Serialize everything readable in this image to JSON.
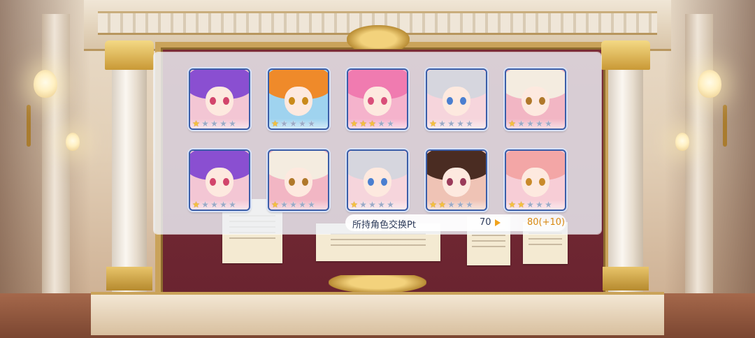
{
  "background": {
    "wall_color": "#e2cfb7",
    "board_color": "#6a2430",
    "gold_color": "#caa35a"
  },
  "panel": {
    "characters": [
      {
        "name_icon": "purple-hair-girl-portrait",
        "hair": "#8a4fd1",
        "eyes": "#d2456b",
        "bg": "#f3c6d4",
        "stars": 1
      },
      {
        "name_icon": "orange-hair-girl-portrait",
        "hair": "#ef8a2a",
        "eyes": "#c98a1a",
        "bg": "#9fd3ef",
        "stars": 1
      },
      {
        "name_icon": "pink-hair-girl-portrait",
        "hair": "#f07bb0",
        "eyes": "#d94f7a",
        "bg": "#f5b3cc",
        "stars": 3
      },
      {
        "name_icon": "silver-hair-horned-girl-portrait",
        "hair": "#d6d6de",
        "eyes": "#4a7fd0",
        "bg": "#f6d5dc",
        "stars": 1
      },
      {
        "name_icon": "alpaca-mascot-portrait",
        "hair": "#f4ece0",
        "eyes": "#b0782a",
        "bg": "#f2b6c4",
        "stars": 1
      },
      {
        "name_icon": "purple-hair-girl-portrait",
        "hair": "#8a4fd1",
        "eyes": "#d2456b",
        "bg": "#f3c6d4",
        "stars": 1
      },
      {
        "name_icon": "alpaca-mascot-portrait",
        "hair": "#f4ece0",
        "eyes": "#b0782a",
        "bg": "#f2b6c4",
        "stars": 1
      },
      {
        "name_icon": "silver-hair-horned-girl-portrait",
        "hair": "#d6d6de",
        "eyes": "#4a7fd0",
        "bg": "#f6d5dc",
        "stars": 1
      },
      {
        "name_icon": "brown-hair-girl-portrait",
        "hair": "#4a2c22",
        "eyes": "#9a3a5a",
        "bg": "#efc3b5",
        "stars": 2
      },
      {
        "name_icon": "pink-hair-earmuff-girl-portrait",
        "hair": "#f3a6a6",
        "eyes": "#c98a2a",
        "bg": "#f7cdd6",
        "stars": 2
      }
    ],
    "max_stars": 5,
    "points": {
      "label": "所持角色交换Pt",
      "current": "70",
      "after": "80(+10)",
      "accent": "#f0a21b"
    }
  }
}
